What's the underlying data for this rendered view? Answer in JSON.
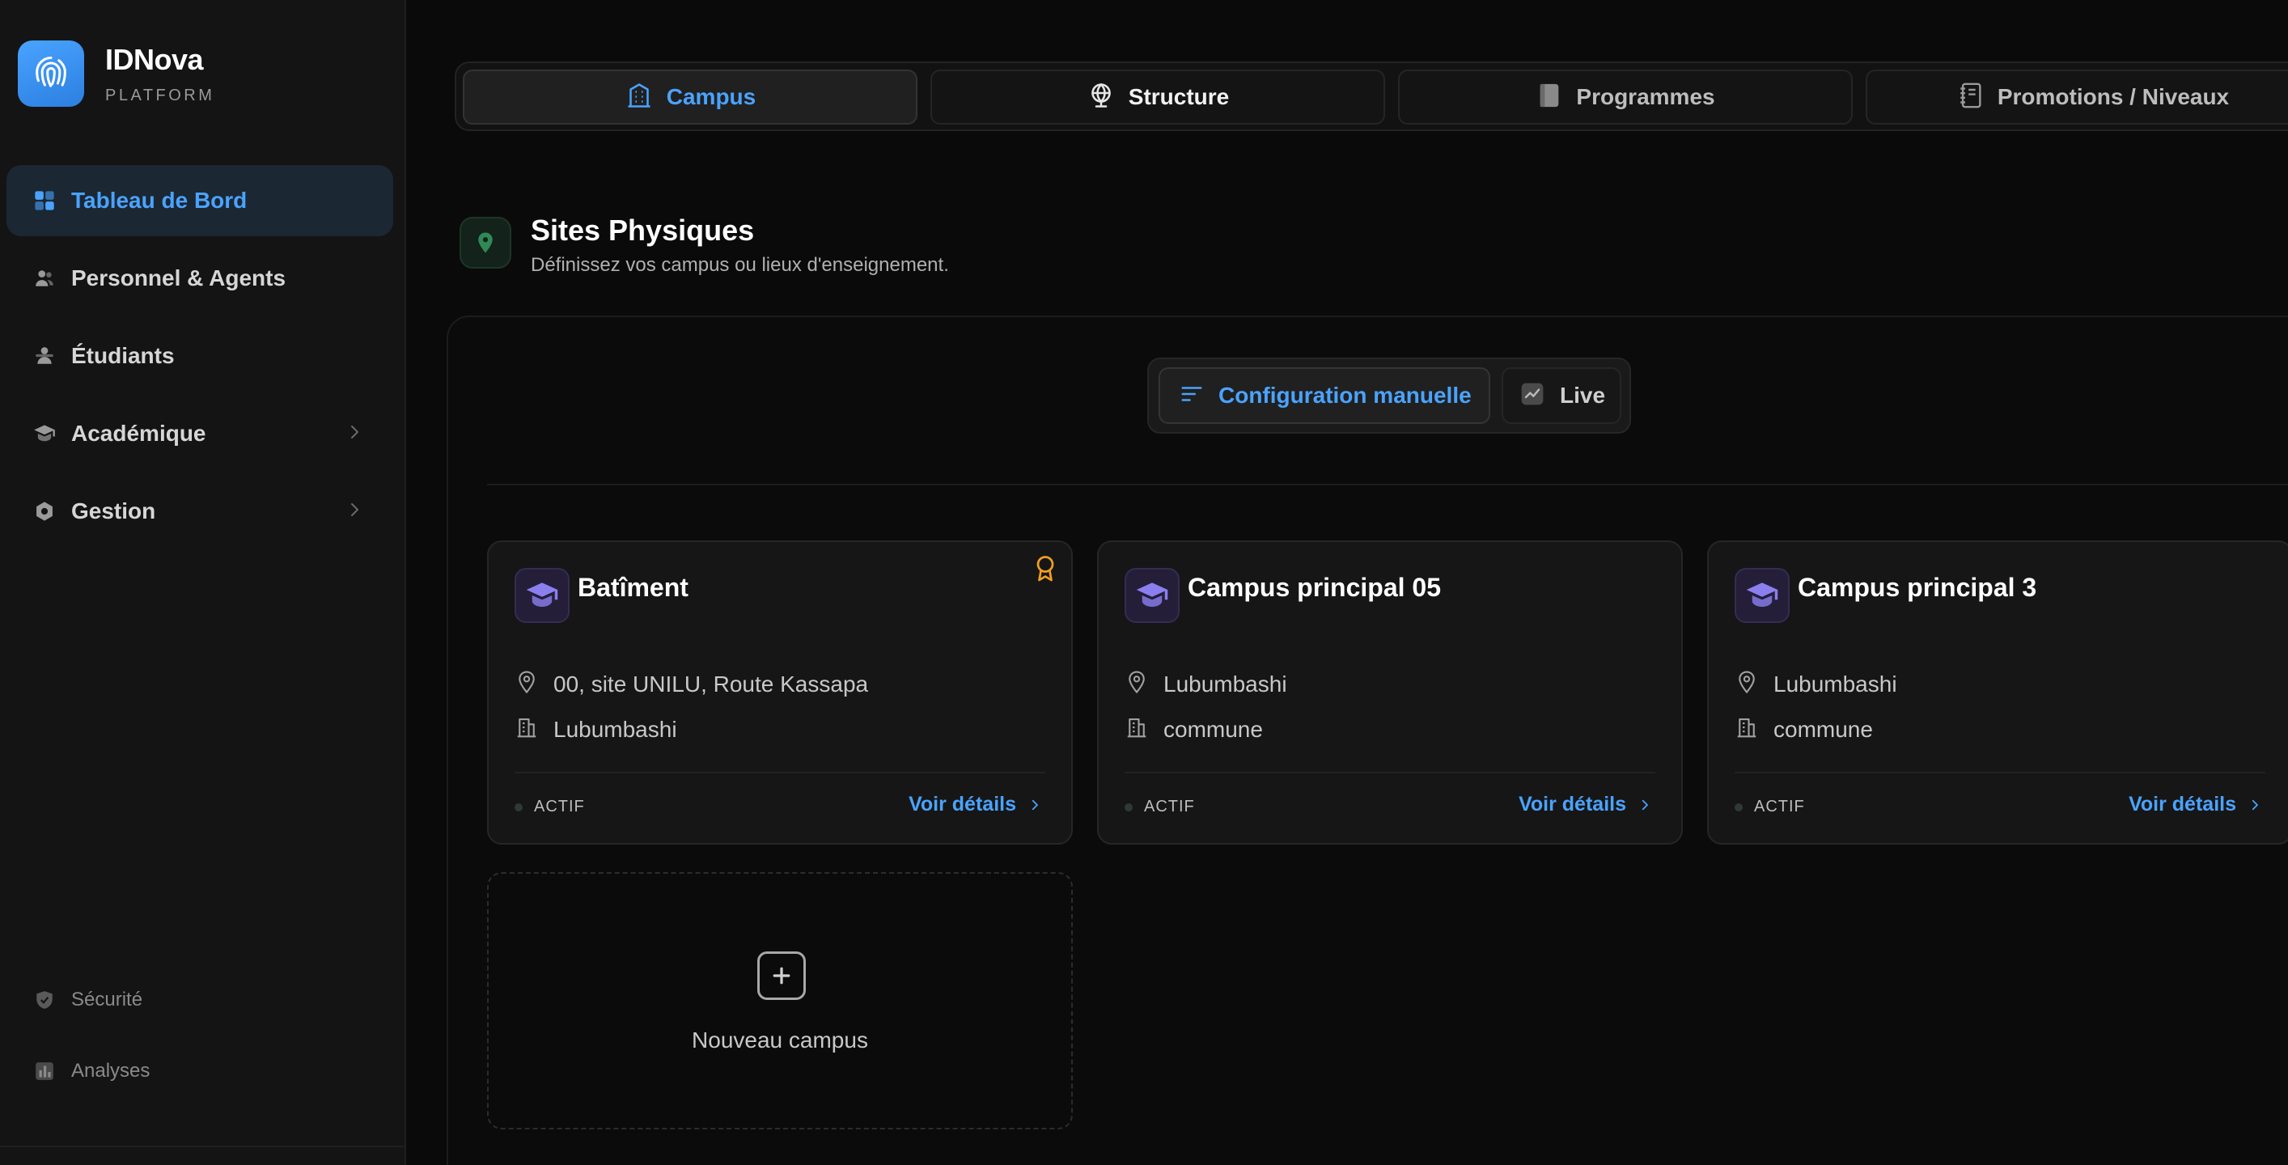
{
  "brand": {
    "name": "IDNova",
    "subtitle": "PLATFORM"
  },
  "sidebar": {
    "items": [
      {
        "label": "Tableau de Bord",
        "icon": "grid-icon",
        "active": true
      },
      {
        "label": "Personnel & Agents",
        "icon": "users-icon"
      },
      {
        "label": "Étudiants",
        "icon": "students-icon"
      },
      {
        "label": "Académique",
        "icon": "graduation-cap-icon",
        "expandable": true
      },
      {
        "label": "Gestion",
        "icon": "settings-icon",
        "expandable": true
      }
    ],
    "bottom_items": [
      {
        "label": "Sécurité",
        "icon": "shield-icon"
      },
      {
        "label": "Analyses",
        "icon": "chart-icon"
      }
    ]
  },
  "tabs": [
    {
      "label": "Campus",
      "icon": "building-icon",
      "active": true
    },
    {
      "label": "Structure",
      "icon": "globe-icon"
    },
    {
      "label": "Programmes",
      "icon": "book-icon"
    },
    {
      "label": "Promotions / Niveaux",
      "icon": "notebook-icon"
    }
  ],
  "section": {
    "title": "Sites Physiques",
    "subtitle": "Définissez vos campus ou lieux d'enseignement."
  },
  "mode_toggle": {
    "manual_label": "Configuration manuelle",
    "live_label": "Live",
    "selected": "manual"
  },
  "campuses": [
    {
      "name": "Batîment",
      "address": "00, site UNILU, Route Kassapa",
      "city": "Lubumbashi",
      "status": "ACTIF",
      "link": "Voir détails",
      "badge": "award-icon"
    },
    {
      "name": "Campus principal 05",
      "address": "Lubumbashi",
      "city": "commune",
      "status": "ACTIF",
      "link": "Voir détails"
    },
    {
      "name": "Campus principal 3",
      "address": "Lubumbashi",
      "city": "commune",
      "status": "ACTIF",
      "link": "Voir détails"
    }
  ],
  "new_campus": {
    "label": "Nouveau campus"
  },
  "colors": {
    "accent": "#4aa3ff",
    "background": "#0a0a0a",
    "sidebar": "#141414",
    "card": "#161616",
    "badge": "#f0a020",
    "campus_icon": "#8b7ff0"
  }
}
